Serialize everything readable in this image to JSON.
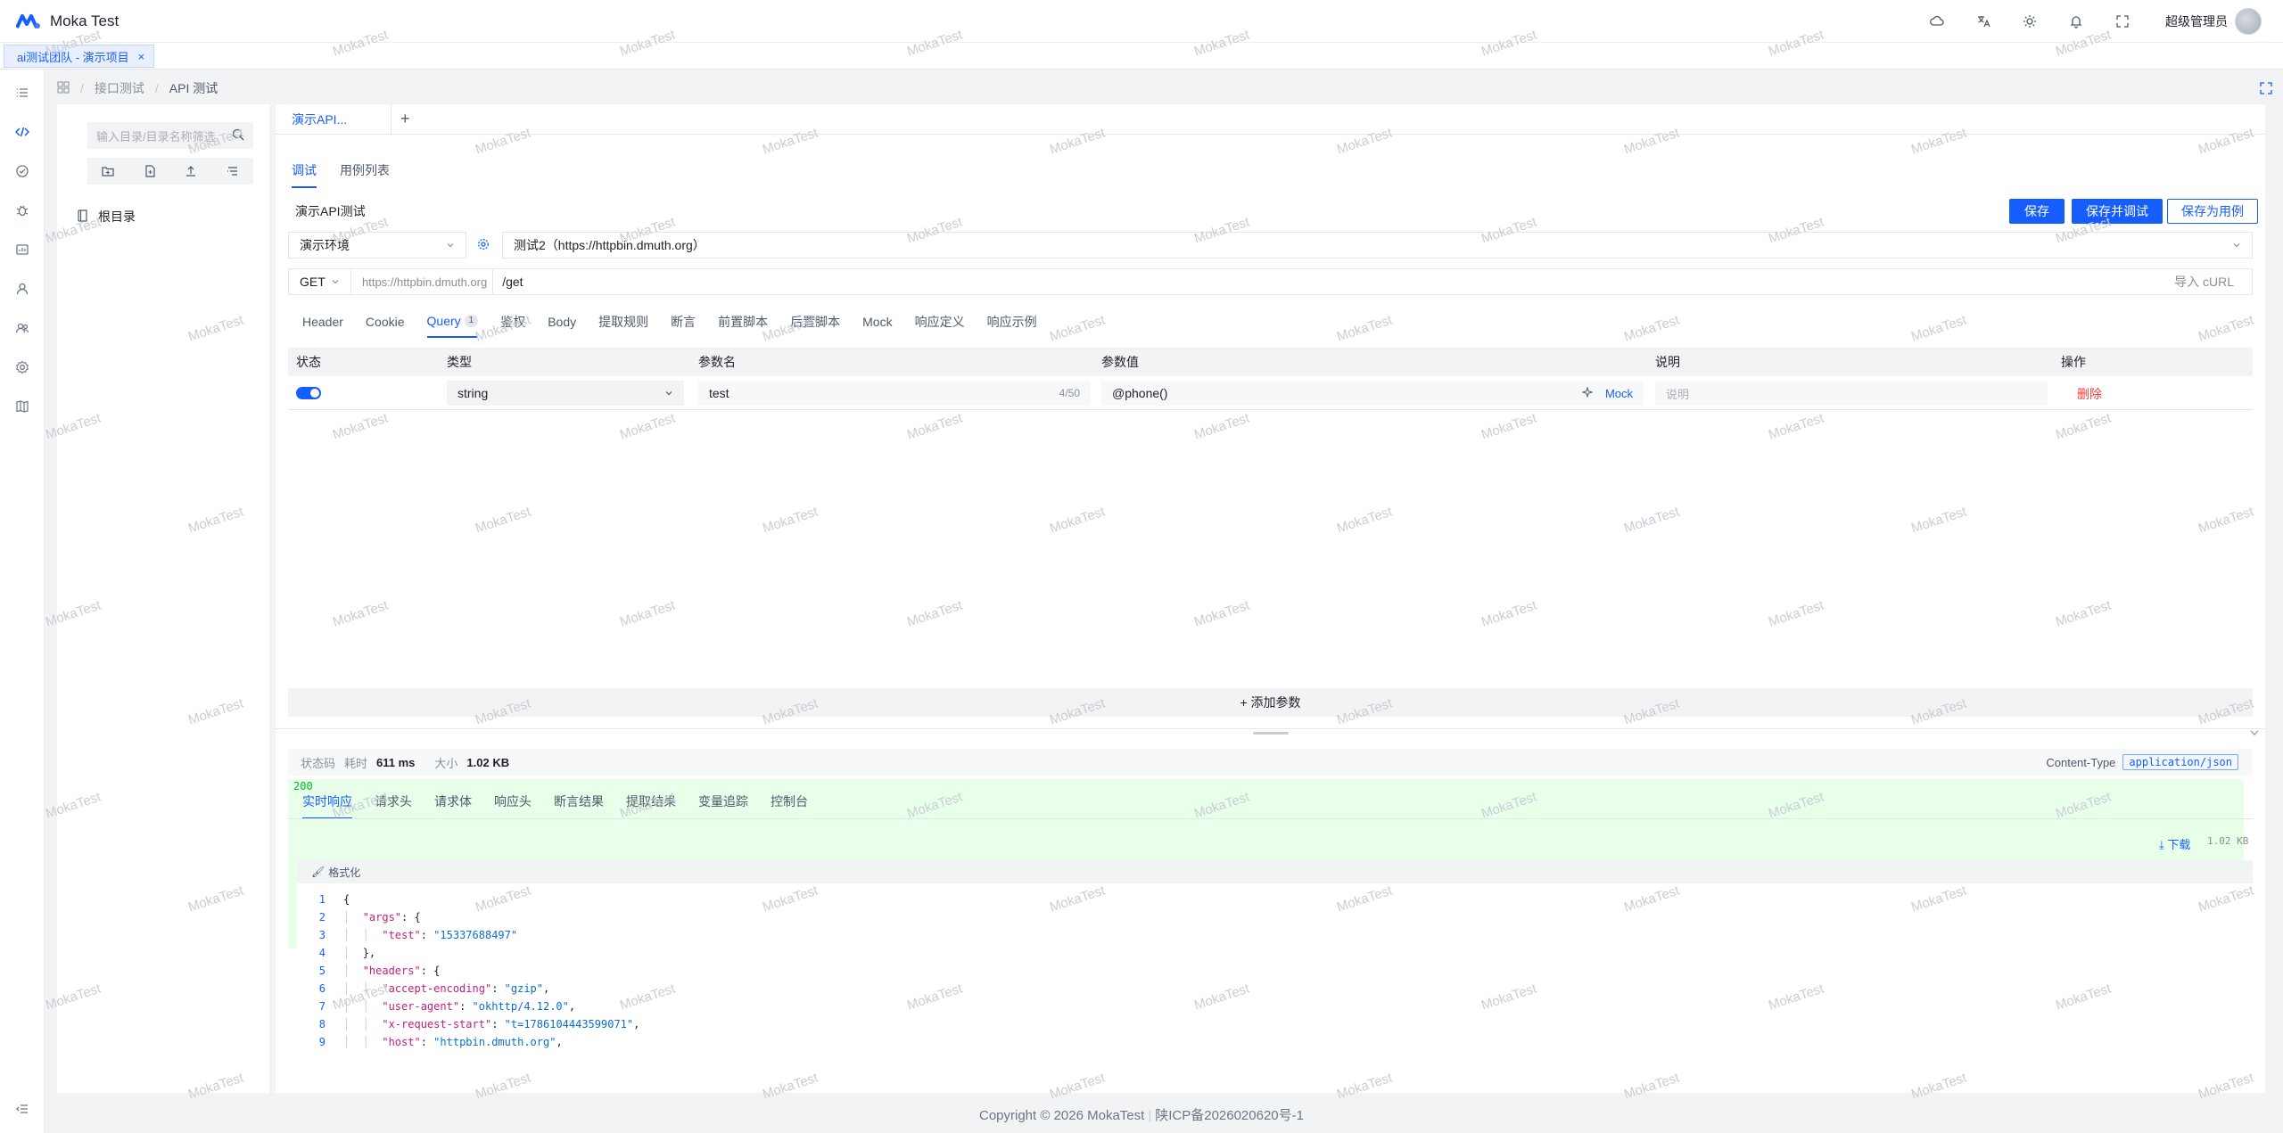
{
  "app": {
    "title": "Moka Test"
  },
  "header": {
    "user_name": "超级管理员"
  },
  "page_tabs": [
    {
      "label": "ai测试团队 - 演示项目",
      "close": "×"
    }
  ],
  "breadcrumb": {
    "items": [
      "接口测试",
      "API 测试"
    ],
    "separator": "/"
  },
  "tree": {
    "search_placeholder": "输入目录/目录名称筛选",
    "root_label": "根目录"
  },
  "api_tab": {
    "label": "演示API...",
    "add": "+"
  },
  "sub_tabs": [
    "调试",
    "用例列表"
  ],
  "api_name": "演示API测试",
  "buttons": {
    "save": "保存",
    "save_debug": "保存并调试",
    "save_case": "保存为用例"
  },
  "env": {
    "selected": "演示环境"
  },
  "server": {
    "selected": "测试2（https://httpbin.dmuth.org）"
  },
  "url": {
    "method": "GET",
    "base": "https://httpbin.dmuth.org",
    "path": "/get",
    "import_curl": "导入 cURL"
  },
  "request_tabs": [
    {
      "label": "Header"
    },
    {
      "label": "Cookie"
    },
    {
      "label": "Query",
      "badge": "1"
    },
    {
      "label": "鉴权"
    },
    {
      "label": "Body"
    },
    {
      "label": "提取规则"
    },
    {
      "label": "断言"
    },
    {
      "label": "前置脚本"
    },
    {
      "label": "后置脚本"
    },
    {
      "label": "Mock"
    },
    {
      "label": "响应定义"
    },
    {
      "label": "响应示例"
    }
  ],
  "params_table": {
    "headers": [
      "状态",
      "类型",
      "参数名",
      "参数值",
      "说明",
      "操作"
    ],
    "rows": [
      {
        "enabled": true,
        "type": "string",
        "name": "test",
        "name_count": "4/50",
        "value": "@phone()",
        "mock": "Mock",
        "desc_placeholder": "说明",
        "action": "删除"
      }
    ],
    "add_label": "+ 添加参数"
  },
  "response_status": {
    "status_label": "状态码",
    "status_code": "200",
    "time_label": "耗时",
    "time_value": "611 ms",
    "size_label": "大小",
    "size_value": "1.02 KB",
    "content_type_label": "Content-Type",
    "content_type_value": "application/json"
  },
  "response_tabs": [
    "实时响应",
    "请求头",
    "请求体",
    "响应头",
    "断言结果",
    "提取结果",
    "变量追踪",
    "控制台"
  ],
  "download": {
    "label": "下载",
    "size": "1.02 KB"
  },
  "format_label": "格式化",
  "code_lines": [
    {
      "n": "1",
      "text": "{"
    },
    {
      "n": "2",
      "key": "\"args\"",
      "rest": ": {"
    },
    {
      "n": "3",
      "key": "\"test\"",
      "rest": ": ",
      "str": "\"15337688497\""
    },
    {
      "n": "4",
      "text": "},"
    },
    {
      "n": "5",
      "key": "\"headers\"",
      "rest": ": {"
    },
    {
      "n": "6",
      "key": "\"accept-encoding\"",
      "rest": ": ",
      "str": "\"gzip\"",
      "tail": ","
    },
    {
      "n": "7",
      "key": "\"user-agent\"",
      "rest": ": ",
      "str": "\"okhttp/4.12.0\"",
      "tail": ","
    },
    {
      "n": "8",
      "key": "\"x-request-start\"",
      "rest": ": ",
      "str": "\"t=1786104443599071\"",
      "tail": ","
    },
    {
      "n": "9",
      "key": "\"host\"",
      "rest": ": ",
      "str": "\"httpbin.dmuth.org\"",
      "tail": ","
    }
  ],
  "footer": {
    "copyright": "Copyright © 2026 MokaTest",
    "icp": "陕ICP备2026020620号-1"
  },
  "watermark": "MokaTest",
  "colors": {
    "primary": "#165dff",
    "danger": "#f53f3f",
    "success": "#00b42a"
  }
}
